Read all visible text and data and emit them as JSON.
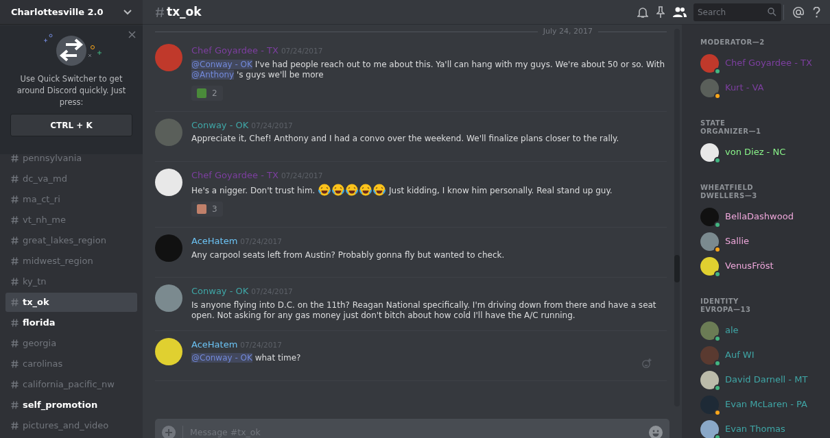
{
  "server": {
    "name": "Charlottesville 2.0"
  },
  "quick_switcher": {
    "text": "Use Quick Switcher to get around Discord quickly. Just press:",
    "shortcut": "CTRL + K"
  },
  "channels": [
    {
      "name": "pennsylvania",
      "selected": false,
      "unread": false
    },
    {
      "name": "dc_va_md",
      "selected": false,
      "unread": false
    },
    {
      "name": "ma_ct_ri",
      "selected": false,
      "unread": false
    },
    {
      "name": "vt_nh_me",
      "selected": false,
      "unread": false
    },
    {
      "name": "great_lakes_region",
      "selected": false,
      "unread": false
    },
    {
      "name": "midwest_region",
      "selected": false,
      "unread": false
    },
    {
      "name": "ky_tn",
      "selected": false,
      "unread": false
    },
    {
      "name": "tx_ok",
      "selected": true,
      "unread": false
    },
    {
      "name": "florida",
      "selected": false,
      "unread": true
    },
    {
      "name": "georgia",
      "selected": false,
      "unread": false
    },
    {
      "name": "carolinas",
      "selected": false,
      "unread": false
    },
    {
      "name": "california_pacific_nw",
      "selected": false,
      "unread": false
    },
    {
      "name": "self_promotion",
      "selected": false,
      "unread": true
    },
    {
      "name": "pictures_and_video",
      "selected": false,
      "unread": false
    }
  ],
  "header": {
    "channel": "tx_ok",
    "search_placeholder": "Search"
  },
  "date_divider": "July 24, 2017",
  "messages": [
    {
      "author": "Chef Goyardee - TX",
      "color": "#7d3fa0",
      "time": "07/24/2017",
      "segments": [
        {
          "kind": "mention",
          "text": "@Conway - OK"
        },
        {
          "kind": "text",
          "text": " I've had people reach out to me about this. Ya'll can hang with my guys. We're about 50 or so. With "
        },
        {
          "kind": "mention",
          "text": "@Anthony"
        },
        {
          "kind": "text",
          "text": " 's guys we'll be more"
        }
      ],
      "reactions": [
        {
          "count": "2"
        }
      ]
    },
    {
      "author": "Conway - OK",
      "color": "#3fa6a6",
      "time": "07/24/2017",
      "segments": [
        {
          "kind": "text",
          "text": "Appreciate it, Chef! Anthony and I had a convo over the weekend. We'll finalize plans closer to the rally."
        }
      ]
    },
    {
      "author": "Chef Goyardee - TX",
      "color": "#7d3fa0",
      "time": "07/24/2017",
      "segments": [
        {
          "kind": "text",
          "text": "He's a nigger. Don't trust him. "
        },
        {
          "kind": "emoji"
        },
        {
          "kind": "emoji"
        },
        {
          "kind": "emoji"
        },
        {
          "kind": "emoji"
        },
        {
          "kind": "emoji"
        },
        {
          "kind": "text",
          "text": " Just kidding, I know him personally. Real stand up guy."
        }
      ],
      "reactions": [
        {
          "count": "3"
        }
      ]
    },
    {
      "author": "AceHatem",
      "color": "#6cc4f5",
      "time": "07/24/2017",
      "segments": [
        {
          "kind": "text",
          "text": "Any carpool seats left from Austin? Probably gonna fly but wanted to check."
        }
      ]
    },
    {
      "author": "Conway - OK",
      "color": "#3fa6a6",
      "time": "07/24/2017",
      "segments": [
        {
          "kind": "text",
          "text": "Is anyone flying into D.C. on the 11th? Reagan National specifically. I'm driving down from there and have a seat open. Not asking for any gas money just don't bitch about how cold I'll have the A/C running."
        }
      ]
    },
    {
      "author": "AceHatem",
      "color": "#6cc4f5",
      "time": "07/24/2017",
      "segments": [
        {
          "kind": "mention",
          "text": "@Conway - OK"
        },
        {
          "kind": "text",
          "text": " what time?"
        }
      ]
    }
  ],
  "composer": {
    "placeholder": "Message #tx_ok"
  },
  "member_groups": [
    {
      "title": "MODERATOR—2",
      "members": [
        {
          "name": "Chef Goyardee - TX",
          "color": "#7d3fa0",
          "idle": false
        },
        {
          "name": "Kurt - VA",
          "color": "#7d3fa0",
          "idle": true
        }
      ]
    },
    {
      "title": "STATE ORGANIZER—1",
      "members": [
        {
          "name": "von Diez - NC",
          "color": "#8af58a",
          "idle": false
        }
      ]
    },
    {
      "title": "WHEATFIELD DWELLERS—3",
      "members": [
        {
          "name": "BellaDashwood",
          "color": "#f0a8dc",
          "idle": false
        },
        {
          "name": "Sallie",
          "color": "#f0a8dc",
          "idle": true
        },
        {
          "name": "VenusFröst",
          "color": "#f0a8dc",
          "idle": false
        }
      ]
    },
    {
      "title": "IDENTITY EVROPA—13",
      "members": [
        {
          "name": "ale",
          "color": "#3fa6a6",
          "idle": false
        },
        {
          "name": "Auf WI",
          "color": "#3fa6a6",
          "idle": false
        },
        {
          "name": "David Darnell - MT",
          "color": "#3fa6a6",
          "idle": false
        },
        {
          "name": "Evan McLaren - PA",
          "color": "#3fa6a6",
          "idle": true
        },
        {
          "name": "Evan Thomas",
          "color": "#3fa6a6",
          "idle": false
        }
      ]
    }
  ]
}
